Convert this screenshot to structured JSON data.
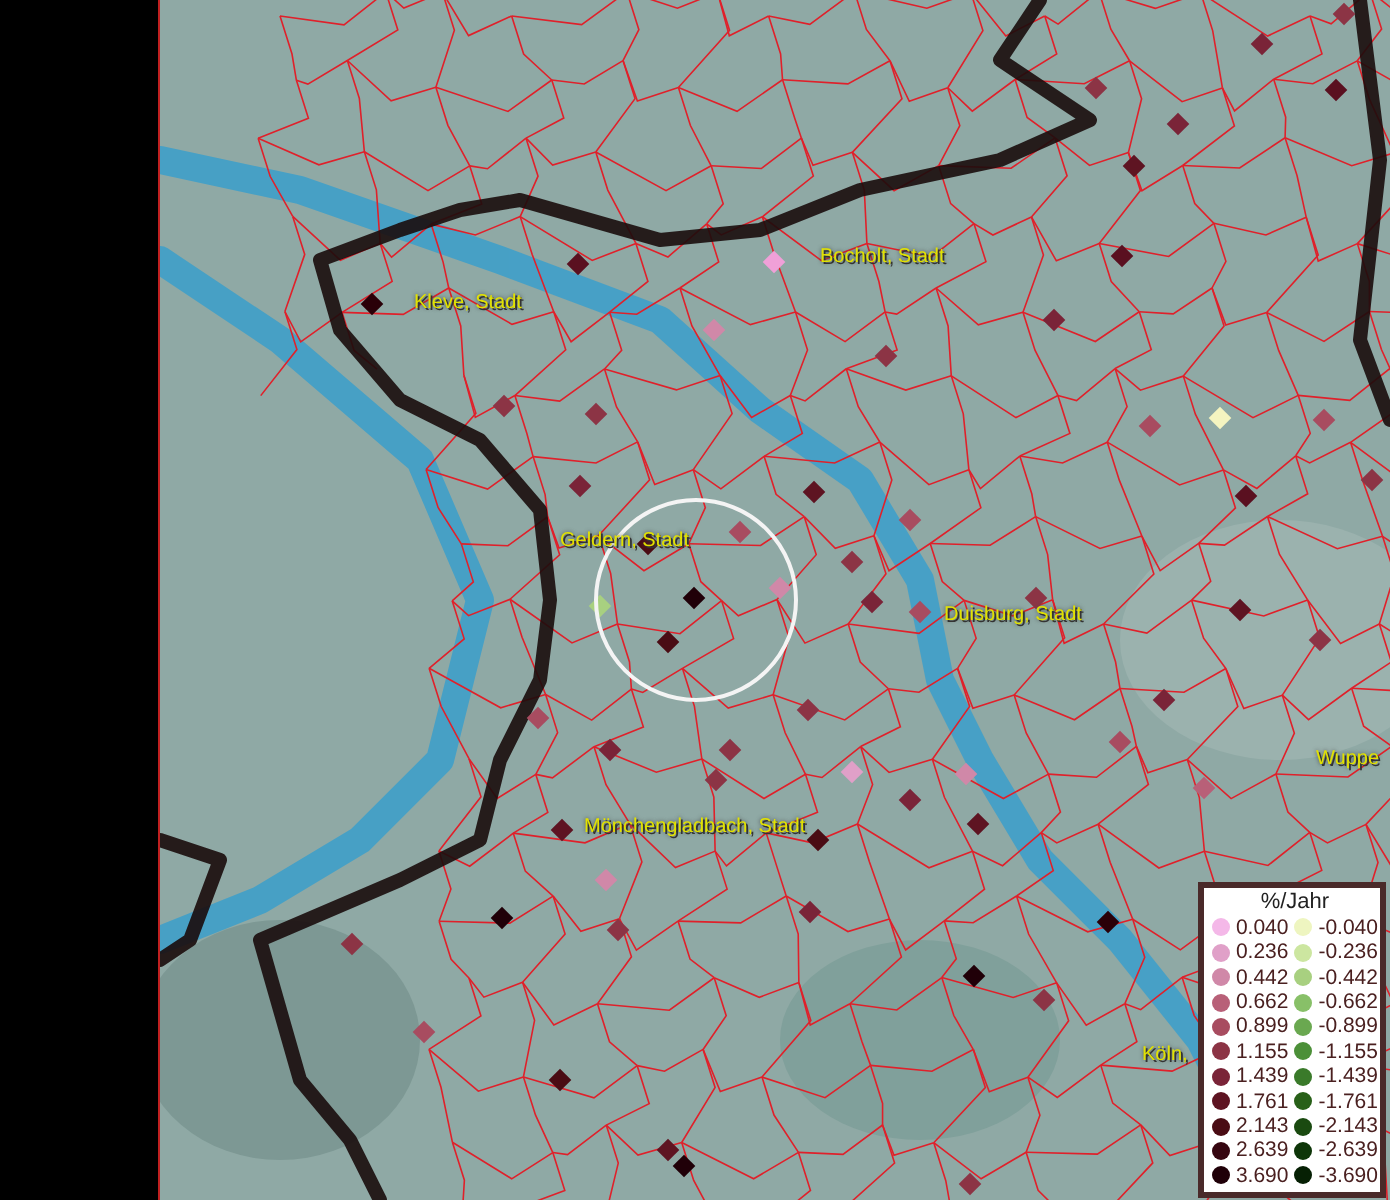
{
  "map": {
    "place_labels": [
      {
        "text": "Kleve, Stadt"
      },
      {
        "text": "Bocholt, Stadt"
      },
      {
        "text": "Geldern, Stadt"
      },
      {
        "text": "Duisburg, Stadt"
      },
      {
        "text": "Mönchengladbach, Stadt"
      },
      {
        "text": "Wuppe"
      },
      {
        "text": "Köln,"
      }
    ]
  },
  "legend": {
    "title": "%/Jahr",
    "positive": [
      {
        "label": "0.040",
        "color": "#f4b8e8"
      },
      {
        "label": "0.236",
        "color": "#e0a0c8"
      },
      {
        "label": "0.442",
        "color": "#d088a8"
      },
      {
        "label": "0.662",
        "color": "#b86078"
      },
      {
        "label": "0.899",
        "color": "#a84c60"
      },
      {
        "label": "1.155",
        "color": "#8c3445"
      },
      {
        "label": "1.439",
        "color": "#7a2438"
      },
      {
        "label": "1.761",
        "color": "#5e1422"
      },
      {
        "label": "2.143",
        "color": "#4a0c14"
      },
      {
        "label": "2.639",
        "color": "#360610"
      },
      {
        "label": "3.690",
        "color": "#200008"
      }
    ],
    "negative": [
      {
        "label": "-0.040",
        "color": "#eef5c0"
      },
      {
        "label": "-0.236",
        "color": "#cce6a0"
      },
      {
        "label": "-0.442",
        "color": "#a8d080"
      },
      {
        "label": "-0.662",
        "color": "#88c068"
      },
      {
        "label": "-0.899",
        "color": "#6aa850"
      },
      {
        "label": "-1.155",
        "color": "#4c9038"
      },
      {
        "label": "-1.439",
        "color": "#3a7a2a"
      },
      {
        "label": "-1.761",
        "color": "#286018"
      },
      {
        "label": "-2.143",
        "color": "#1a4a10"
      },
      {
        "label": "-2.639",
        "color": "#0e3608"
      },
      {
        "label": "-3.690",
        "color": "#062004"
      }
    ]
  }
}
